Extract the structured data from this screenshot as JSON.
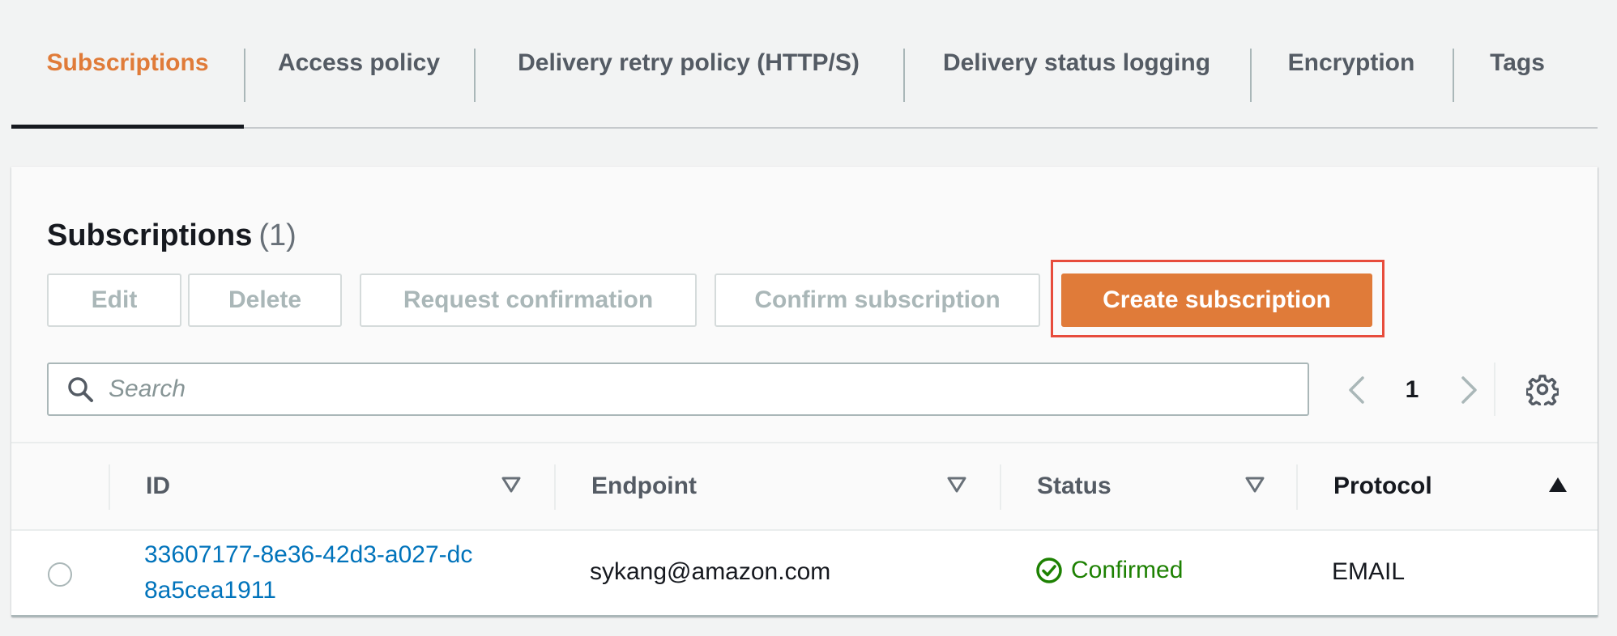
{
  "tabs": [
    {
      "label": "Subscriptions",
      "active": true
    },
    {
      "label": "Access policy",
      "active": false
    },
    {
      "label": "Delivery retry policy (HTTP/S)",
      "active": false
    },
    {
      "label": "Delivery status logging",
      "active": false
    },
    {
      "label": "Encryption",
      "active": false
    },
    {
      "label": "Tags",
      "active": false
    }
  ],
  "panel": {
    "title": "Subscriptions",
    "count": "(1)"
  },
  "buttons": {
    "edit": "Edit",
    "delete": "Delete",
    "request_confirmation": "Request confirmation",
    "confirm_subscription": "Confirm subscription",
    "create_subscription": "Create subscription"
  },
  "search": {
    "placeholder": "Search",
    "value": ""
  },
  "pagination": {
    "current_page": "1"
  },
  "table": {
    "columns": [
      "ID",
      "Endpoint",
      "Status",
      "Protocol"
    ],
    "sort": {
      "column": "Protocol",
      "direction": "ascending"
    },
    "rows": [
      {
        "id": "33607177-8e36-42d3-a027-dc8a5cea1911",
        "endpoint": "sykang@amazon.com",
        "status": "Confirmed",
        "protocol": "EMAIL"
      }
    ]
  },
  "colors": {
    "accent": "#e07b39",
    "link": "#0073bb",
    "success": "#1d8102",
    "highlight": "#e74c3c"
  },
  "icons": [
    "search-icon",
    "chevron-left-icon",
    "chevron-right-icon",
    "gear-icon",
    "sort-down-icon",
    "sort-up-icon",
    "check-circle-icon"
  ]
}
